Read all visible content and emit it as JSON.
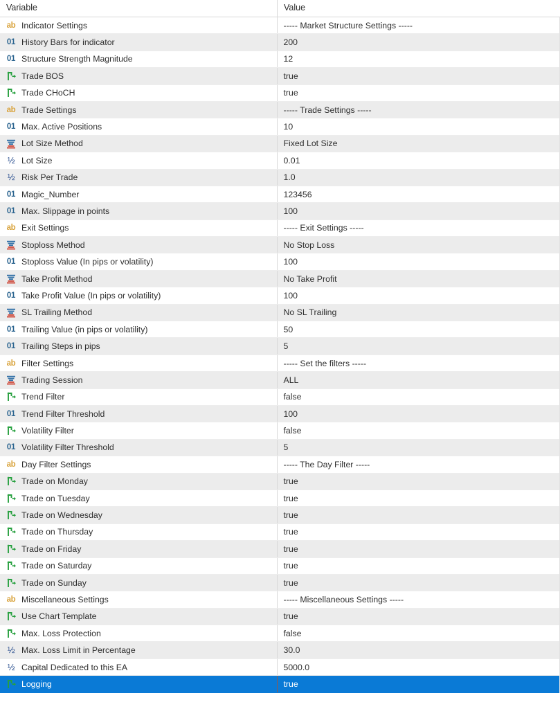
{
  "header": {
    "variable_label": "Variable",
    "value_label": "Value"
  },
  "icons": {
    "string": "ab-string-icon",
    "int": "01-integer-icon",
    "double": "half-fraction-double-icon",
    "bool": "green-fork-arrow-bool-icon",
    "enum": "stacked-bars-enum-icon"
  },
  "colors": {
    "selection": "#0a7ad6",
    "alt_row": "#ececec",
    "row": "#ffffff",
    "icon_string": "#d9a33c",
    "icon_int": "#2c6590",
    "icon_double": "#2a4f8f",
    "icon_bool": "#27a03f",
    "icon_enum_blue": "#2f6ea5",
    "icon_enum_red": "#cf4b3c",
    "text": "#2f2f2f"
  },
  "rows": [
    {
      "icon": "string",
      "name": "Indicator Settings",
      "value": "----- Market Structure Settings -----",
      "selected": false
    },
    {
      "icon": "int",
      "name": "History Bars for indicator",
      "value": "200",
      "selected": false
    },
    {
      "icon": "int",
      "name": "Structure Strength Magnitude",
      "value": "12",
      "selected": false
    },
    {
      "icon": "bool",
      "name": "Trade BOS",
      "value": "true",
      "selected": false
    },
    {
      "icon": "bool",
      "name": "Trade CHoCH",
      "value": "true",
      "selected": false
    },
    {
      "icon": "string",
      "name": "Trade Settings",
      "value": "----- Trade Settings -----",
      "selected": false
    },
    {
      "icon": "int",
      "name": "Max. Active Positions",
      "value": "10",
      "selected": false
    },
    {
      "icon": "enum",
      "name": "Lot Size Method",
      "value": "Fixed Lot Size",
      "selected": false
    },
    {
      "icon": "double",
      "name": "Lot Size",
      "value": "0.01",
      "selected": false
    },
    {
      "icon": "double",
      "name": "Risk Per Trade",
      "value": "1.0",
      "selected": false
    },
    {
      "icon": "int",
      "name": "Magic_Number",
      "value": "123456",
      "selected": false
    },
    {
      "icon": "int",
      "name": "Max. Slippage in points",
      "value": "100",
      "selected": false
    },
    {
      "icon": "string",
      "name": "Exit Settings",
      "value": "----- Exit Settings -----",
      "selected": false
    },
    {
      "icon": "enum",
      "name": "Stoploss Method",
      "value": "No Stop Loss",
      "selected": false
    },
    {
      "icon": "int",
      "name": "Stoploss Value (In pips or volatility)",
      "value": "100",
      "selected": false
    },
    {
      "icon": "enum",
      "name": "Take Profit Method",
      "value": "No Take Profit",
      "selected": false
    },
    {
      "icon": "int",
      "name": "Take Profit Value (In pips or volatility)",
      "value": "100",
      "selected": false
    },
    {
      "icon": "enum",
      "name": "SL Trailing Method",
      "value": "No SL Trailing",
      "selected": false
    },
    {
      "icon": "int",
      "name": "Trailing Value (in pips or volatility)",
      "value": "50",
      "selected": false
    },
    {
      "icon": "int",
      "name": "Trailing Steps in pips",
      "value": "5",
      "selected": false
    },
    {
      "icon": "string",
      "name": "Filter Settings",
      "value": "----- Set the filters -----",
      "selected": false
    },
    {
      "icon": "enum",
      "name": "Trading Session",
      "value": "ALL",
      "selected": false
    },
    {
      "icon": "bool",
      "name": "Trend Filter",
      "value": "false",
      "selected": false
    },
    {
      "icon": "int",
      "name": "Trend Filter Threshold",
      "value": "100",
      "selected": false
    },
    {
      "icon": "bool",
      "name": "Volatility Filter",
      "value": "false",
      "selected": false
    },
    {
      "icon": "int",
      "name": "Volatility Filter Threshold",
      "value": "5",
      "selected": false
    },
    {
      "icon": "string",
      "name": "Day Filter Settings",
      "value": "----- The Day Filter -----",
      "selected": false
    },
    {
      "icon": "bool",
      "name": "Trade on Monday",
      "value": "true",
      "selected": false
    },
    {
      "icon": "bool",
      "name": "Trade on Tuesday",
      "value": "true",
      "selected": false
    },
    {
      "icon": "bool",
      "name": "Trade on Wednesday",
      "value": "true",
      "selected": false
    },
    {
      "icon": "bool",
      "name": "Trade on Thursday",
      "value": "true",
      "selected": false
    },
    {
      "icon": "bool",
      "name": "Trade on Friday",
      "value": "true",
      "selected": false
    },
    {
      "icon": "bool",
      "name": "Trade on Saturday",
      "value": "true",
      "selected": false
    },
    {
      "icon": "bool",
      "name": "Trade on Sunday",
      "value": "true",
      "selected": false
    },
    {
      "icon": "string",
      "name": "Miscellaneous Settings",
      "value": "----- Miscellaneous Settings -----",
      "selected": false
    },
    {
      "icon": "bool",
      "name": "Use Chart Template",
      "value": "true",
      "selected": false
    },
    {
      "icon": "bool",
      "name": "Max. Loss Protection",
      "value": "false",
      "selected": false
    },
    {
      "icon": "double",
      "name": "Max. Loss Limit in Percentage",
      "value": "30.0",
      "selected": false
    },
    {
      "icon": "double",
      "name": "Capital Dedicated to this EA",
      "value": "5000.0",
      "selected": false
    },
    {
      "icon": "bool",
      "name": "Logging",
      "value": "true",
      "selected": true
    }
  ]
}
